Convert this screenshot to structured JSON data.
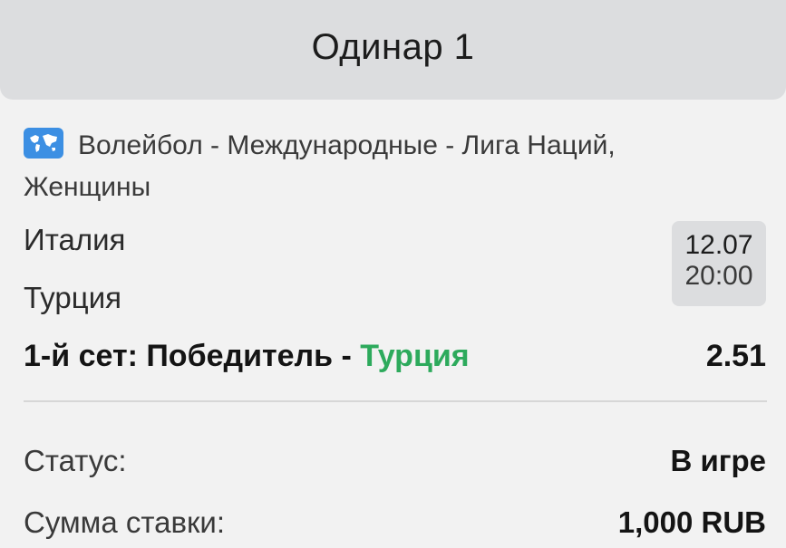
{
  "header": {
    "title": "Одинар 1"
  },
  "bet": {
    "league_icon": "world-map-icon",
    "league": "Волейбол - Международные - Лига Наций, Женщины",
    "team1": "Италия",
    "team2": "Турция",
    "date": "12.07",
    "time": "20:00",
    "market": "1-й сет: Победитель",
    "separator": " - ",
    "pick": "Турция",
    "odds": "2.51",
    "pick_color": "#2daa5c"
  },
  "details": {
    "status_label": "Статус:",
    "status_value": "В игре",
    "stake_label": "Сумма ставки:",
    "stake_value": "1,000 RUB"
  }
}
